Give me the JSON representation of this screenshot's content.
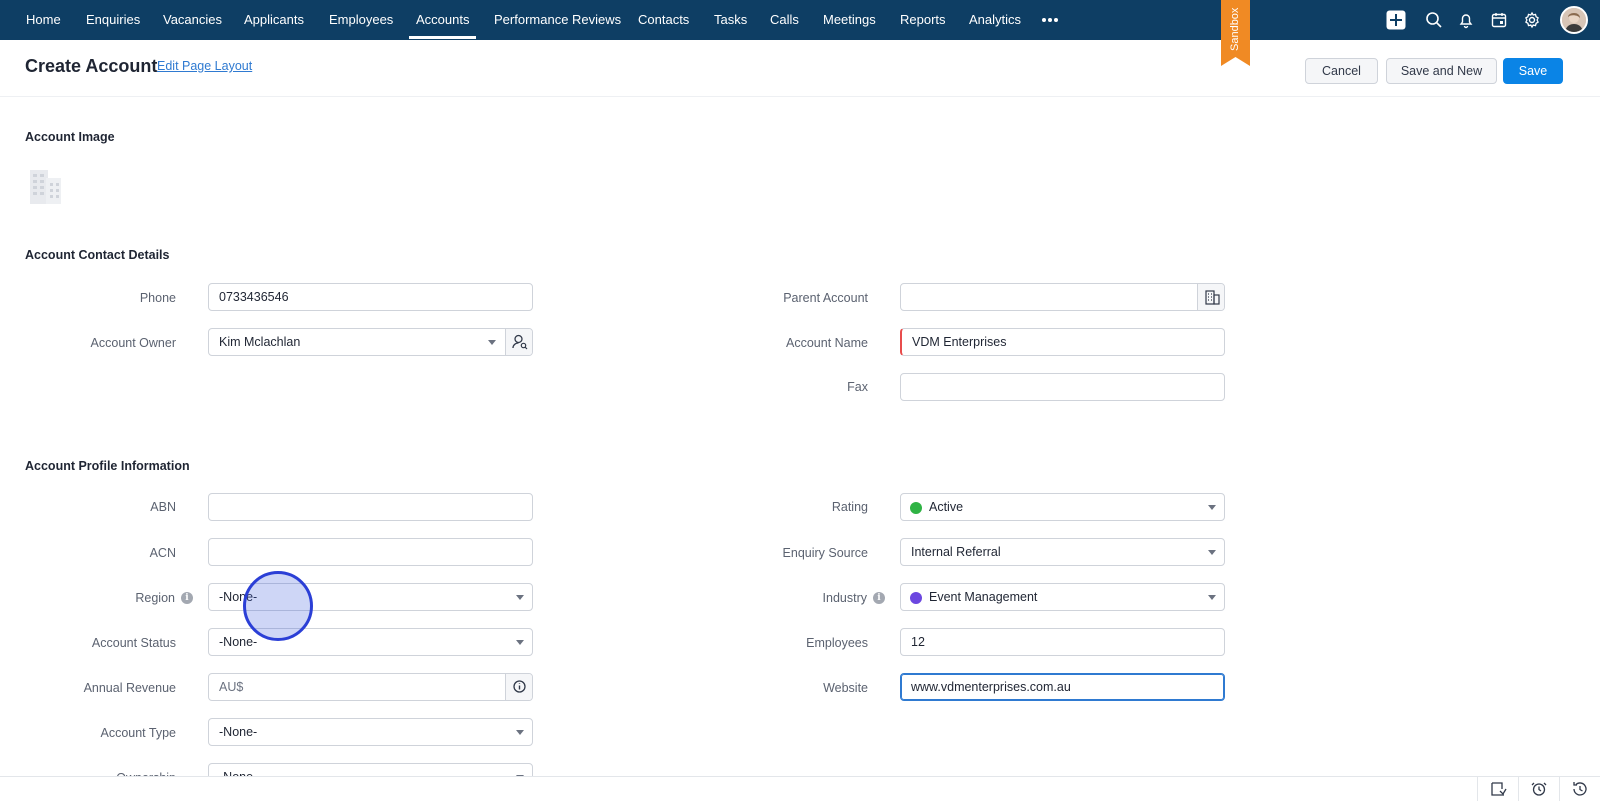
{
  "nav": {
    "items": [
      {
        "label": "Home",
        "active": false
      },
      {
        "label": "Enquiries",
        "active": false
      },
      {
        "label": "Vacancies",
        "active": false
      },
      {
        "label": "Applicants",
        "active": false
      },
      {
        "label": "Employees",
        "active": false
      },
      {
        "label": "Accounts",
        "active": true
      },
      {
        "label": "Performance Reviews",
        "active": false
      },
      {
        "label": "Contacts",
        "active": false
      },
      {
        "label": "Tasks",
        "active": false
      },
      {
        "label": "Calls",
        "active": false
      },
      {
        "label": "Meetings",
        "active": false
      },
      {
        "label": "Reports",
        "active": false
      },
      {
        "label": "Analytics",
        "active": false
      }
    ],
    "more_icon": "more-horizontal-icon",
    "sandbox_label": "Sandbox",
    "icons": [
      "plus-icon",
      "search-icon",
      "bell-icon",
      "calendar-icon",
      "gear-icon"
    ],
    "colors": {
      "bar": "#0e3e64",
      "sandbox": "#f08a24"
    }
  },
  "header": {
    "title": "Create Account",
    "edit_layout": "Edit Page Layout",
    "cancel": "Cancel",
    "save_and_new": "Save and New",
    "save": "Save"
  },
  "sections": {
    "image": {
      "title": "Account Image",
      "icon": "building-placeholder-icon"
    },
    "contact": {
      "title": "Account Contact Details",
      "phone": {
        "label": "Phone",
        "value": "0733436546"
      },
      "owner": {
        "label": "Account Owner",
        "value": "Kim Mclachlan"
      },
      "parent": {
        "label": "Parent Account",
        "value": ""
      },
      "name": {
        "label": "Account Name",
        "value": "VDM Enterprises"
      },
      "fax": {
        "label": "Fax",
        "value": ""
      }
    },
    "profile": {
      "title": "Account Profile Information",
      "abn": {
        "label": "ABN",
        "value": ""
      },
      "acn": {
        "label": "ACN",
        "value": ""
      },
      "region": {
        "label": "Region",
        "value": "-None-"
      },
      "status": {
        "label": "Account Status",
        "value": "-None-"
      },
      "revenue": {
        "label": "Annual Revenue",
        "placeholder": "AU$"
      },
      "type": {
        "label": "Account Type",
        "value": "-None-"
      },
      "ownership": {
        "label": "Ownership",
        "value": "-None-"
      },
      "rating": {
        "label": "Rating",
        "value": "Active",
        "dot_color": "#2fb344"
      },
      "source": {
        "label": "Enquiry Source",
        "value": "Internal Referral"
      },
      "industry": {
        "label": "Industry",
        "value": "Event Management",
        "dot_color": "#6c47e0"
      },
      "employees": {
        "label": "Employees",
        "value": "12"
      },
      "website": {
        "label": "Website",
        "value": "www.vdmenterprises.com.au"
      }
    }
  },
  "bottom_icons": [
    "recent-items-icon",
    "alarm-clock-icon",
    "history-icon"
  ]
}
